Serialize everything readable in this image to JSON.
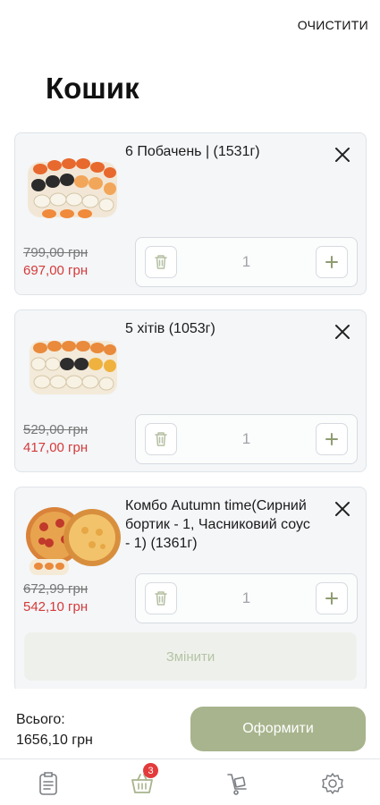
{
  "header": {
    "clear_label": "ОЧИСТИТИ",
    "title": "Кошик"
  },
  "cart": {
    "items": [
      {
        "name": "6 Побачень | (1531г)",
        "old_price": "799,00 грн",
        "new_price": "697,00 грн",
        "quantity": "1"
      },
      {
        "name": "5 хітів (1053г)",
        "old_price": "529,00 грн",
        "new_price": "417,00 грн",
        "quantity": "1"
      },
      {
        "name": "Комбо Autumn time(Сирний бортик - 1, Часниковий соус - 1) (1361г)",
        "old_price": "672,99 грн",
        "new_price": "542,10 грн",
        "quantity": "1",
        "change_label": "Змінити"
      }
    ]
  },
  "footer": {
    "total_label": "Всього:",
    "total_value": "1656,10 грн",
    "checkout_label": "Оформити"
  },
  "tabbar": {
    "cart_badge": "3"
  },
  "colors": {
    "accent": "#a8b48d",
    "discount": "#d43a3a",
    "badge": "#e33b3b"
  },
  "icons": [
    "close-icon",
    "trash-icon",
    "plus-icon",
    "menu-list-icon",
    "cart-icon",
    "delivery-icon",
    "gear-icon"
  ]
}
